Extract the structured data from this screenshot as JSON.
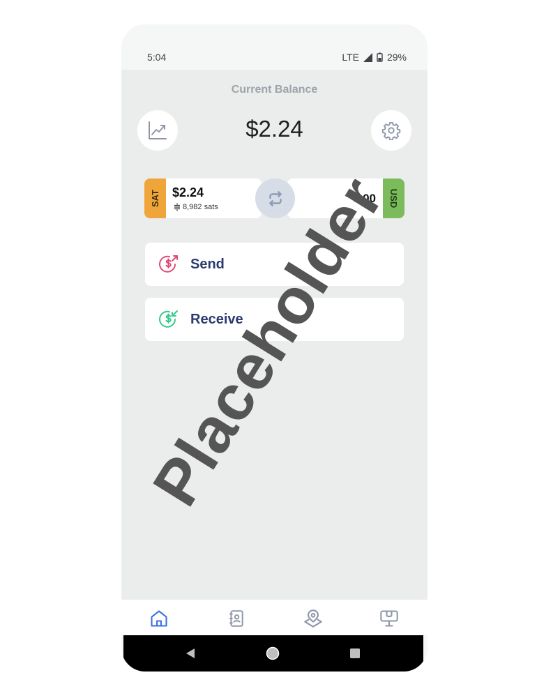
{
  "status": {
    "time": "5:04",
    "network": "LTE",
    "battery": "29%"
  },
  "balance": {
    "title": "Current Balance",
    "amount": "$2.24"
  },
  "sat_card": {
    "tab_label": "SAT",
    "amount": "$2.24",
    "sats": "8,982 sats"
  },
  "usd_card": {
    "tab_label": "USD",
    "amount": "0.00"
  },
  "actions": {
    "send_label": "Send",
    "receive_label": "Receive"
  },
  "nav": {
    "items": [
      "home",
      "contacts",
      "map",
      "learn"
    ],
    "active": "home"
  },
  "overlay": {
    "watermark": "Placeholder"
  },
  "colors": {
    "sat": "#f0a53a",
    "usd": "#7cbb5c",
    "send": "#e04a77",
    "receive": "#34c98a",
    "accent": "#2b3b6e",
    "nav_active": "#3b6fe0"
  }
}
